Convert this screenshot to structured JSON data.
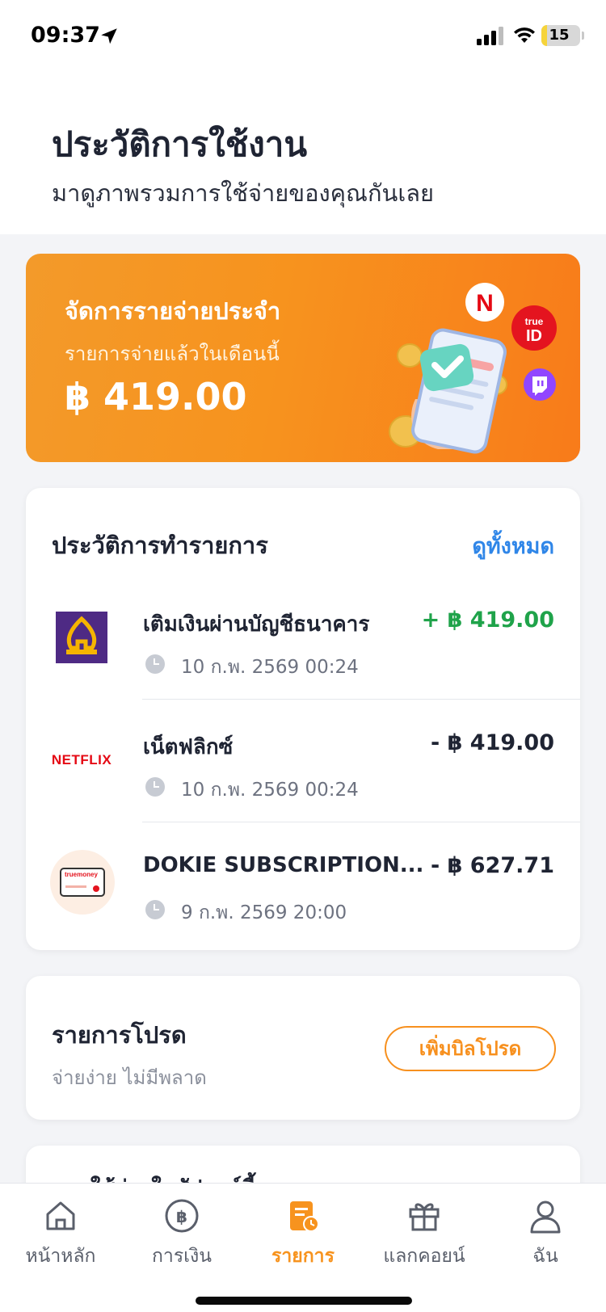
{
  "status_bar": {
    "time": "09:37",
    "battery": "15",
    "battery_level": 0.15
  },
  "header": {
    "title": "ประวัติการใช้งาน",
    "subtitle": "มาดูภาพรวมการใช้จ่ายของคุณกันเลย"
  },
  "banner": {
    "title": "จัดการรายจ่ายประจำ",
    "subtitle": "รายการจ่ายแล้วในเดือนนี้",
    "amount": "฿ 419.00",
    "color_start": "#f39a2a",
    "color_end": "#f87b1a",
    "badges": [
      {
        "icon": "netflix-icon",
        "text": "N"
      },
      {
        "icon": "trueid-icon",
        "text": "true ID"
      },
      {
        "icon": "twitch-icon"
      }
    ]
  },
  "history": {
    "title": "ประวัติการทำรายการ",
    "see_all": "ดูทั้งหมด",
    "items": [
      {
        "icon": "bank-icon",
        "name": "เติมเงินผ่านบัญชีธนาคาร",
        "time": "10 ก.พ. 2569 00:24",
        "amount": "+ ฿ 419.00",
        "color": "#1fa34a"
      },
      {
        "icon": "netflix-logo",
        "logo_text": "NETFLIX",
        "name": "เน็ตฟลิกซ์",
        "time": "10 ก.พ. 2569 00:24",
        "amount": "- ฿ 419.00",
        "color": "#1f2433"
      },
      {
        "icon": "truemoney-card-icon",
        "logo_text": "truemoney",
        "name": "DOKIE SUBSCRIPTION...",
        "time": "9 ก.พ. 2569 20:00",
        "amount": "- ฿ 627.71",
        "color": "#1f2433"
      }
    ]
  },
  "favorite_bills": {
    "title": "รายการโปรด",
    "subtitle": "จ่ายง่าย ไม่มีพลาด",
    "add_button": "เพิ่มบิลโปรด"
  },
  "peek_card": {
    "text": "ใช้จ่ายในสัปดาห์นี้"
  },
  "tabbar": {
    "accent": "#f7931e",
    "items": [
      {
        "icon": "home-icon",
        "label": "หน้าหลัก",
        "active": false
      },
      {
        "icon": "baht-coin-icon",
        "label": "การเงิน",
        "active": false
      },
      {
        "icon": "receipt-icon",
        "label": "รายการ",
        "active": true
      },
      {
        "icon": "gift-icon",
        "label": "แลกคอยน์",
        "active": false
      },
      {
        "icon": "user-icon",
        "label": "ฉัน",
        "active": false
      }
    ]
  }
}
